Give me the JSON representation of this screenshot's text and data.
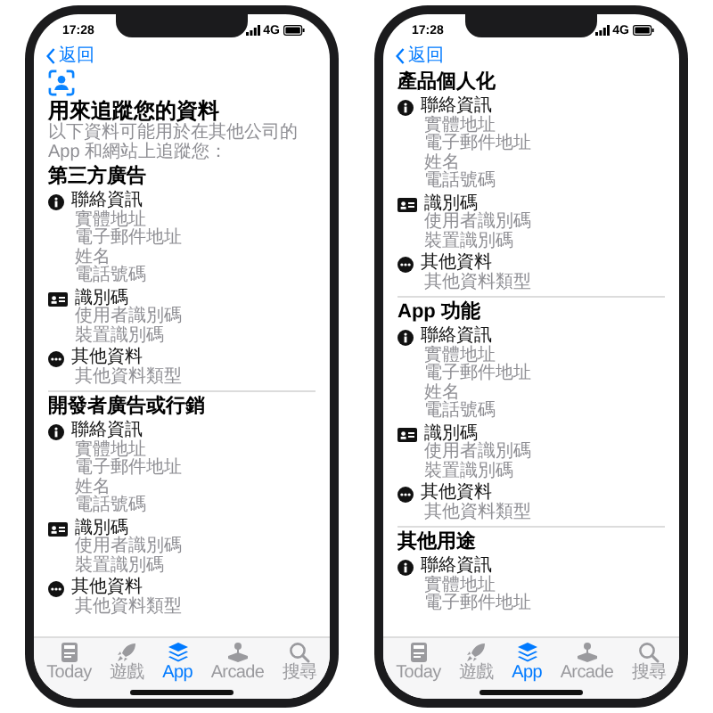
{
  "phones": [
    {
      "status_bar": {
        "time": "17:28",
        "network": "4G"
      },
      "back_label": "返回",
      "header": {
        "title": "用來追蹤您的資料",
        "subtitle": "以下資料可能用於在其他公司的 App 和網站上追蹤您："
      },
      "sections": [
        {
          "title": "第三方廣告",
          "groups": [
            {
              "kind": "contact",
              "label": "聯絡資訊",
              "items": [
                "實體地址",
                "電子郵件地址",
                "姓名",
                "電話號碼"
              ]
            },
            {
              "kind": "identifier",
              "label": "識別碼",
              "items": [
                "使用者識別碼",
                "裝置識別碼"
              ]
            },
            {
              "kind": "other",
              "label": "其他資料",
              "items": [
                "其他資料類型"
              ]
            }
          ]
        },
        {
          "title": "開發者廣告或行銷",
          "groups": [
            {
              "kind": "contact",
              "label": "聯絡資訊",
              "items": [
                "實體地址",
                "電子郵件地址",
                "姓名",
                "電話號碼"
              ]
            },
            {
              "kind": "identifier",
              "label": "識別碼",
              "items": [
                "使用者識別碼",
                "裝置識別碼"
              ]
            },
            {
              "kind": "other",
              "label": "其他資料",
              "items": [
                "其他資料類型"
              ]
            }
          ]
        }
      ],
      "tabs": [
        {
          "kind": "today",
          "label": "Today",
          "selected": false
        },
        {
          "kind": "games",
          "label": "遊戲",
          "selected": false
        },
        {
          "kind": "apps",
          "label": "App",
          "selected": true
        },
        {
          "kind": "arcade",
          "label": "Arcade",
          "selected": false
        },
        {
          "kind": "search",
          "label": "搜尋",
          "selected": false
        }
      ]
    },
    {
      "status_bar": {
        "time": "17:28",
        "network": "4G"
      },
      "back_label": "返回",
      "sections": [
        {
          "title": "產品個人化",
          "groups": [
            {
              "kind": "contact",
              "label": "聯絡資訊",
              "items": [
                "實體地址",
                "電子郵件地址",
                "姓名",
                "電話號碼"
              ]
            },
            {
              "kind": "identifier",
              "label": "識別碼",
              "items": [
                "使用者識別碼",
                "裝置識別碼"
              ]
            },
            {
              "kind": "other",
              "label": "其他資料",
              "items": [
                "其他資料類型"
              ]
            }
          ]
        },
        {
          "title": "App 功能",
          "groups": [
            {
              "kind": "contact",
              "label": "聯絡資訊",
              "items": [
                "實體地址",
                "電子郵件地址",
                "姓名",
                "電話號碼"
              ]
            },
            {
              "kind": "identifier",
              "label": "識別碼",
              "items": [
                "使用者識別碼",
                "裝置識別碼"
              ]
            },
            {
              "kind": "other",
              "label": "其他資料",
              "items": [
                "其他資料類型"
              ]
            }
          ]
        },
        {
          "title": "其他用途",
          "groups": [
            {
              "kind": "contact",
              "label": "聯絡資訊",
              "items": [
                "實體地址",
                "電子郵件地址"
              ]
            }
          ]
        }
      ],
      "tabs": [
        {
          "kind": "today",
          "label": "Today",
          "selected": false
        },
        {
          "kind": "games",
          "label": "遊戲",
          "selected": false
        },
        {
          "kind": "apps",
          "label": "App",
          "selected": true
        },
        {
          "kind": "arcade",
          "label": "Arcade",
          "selected": false
        },
        {
          "kind": "search",
          "label": "搜尋",
          "selected": false
        }
      ]
    }
  ]
}
